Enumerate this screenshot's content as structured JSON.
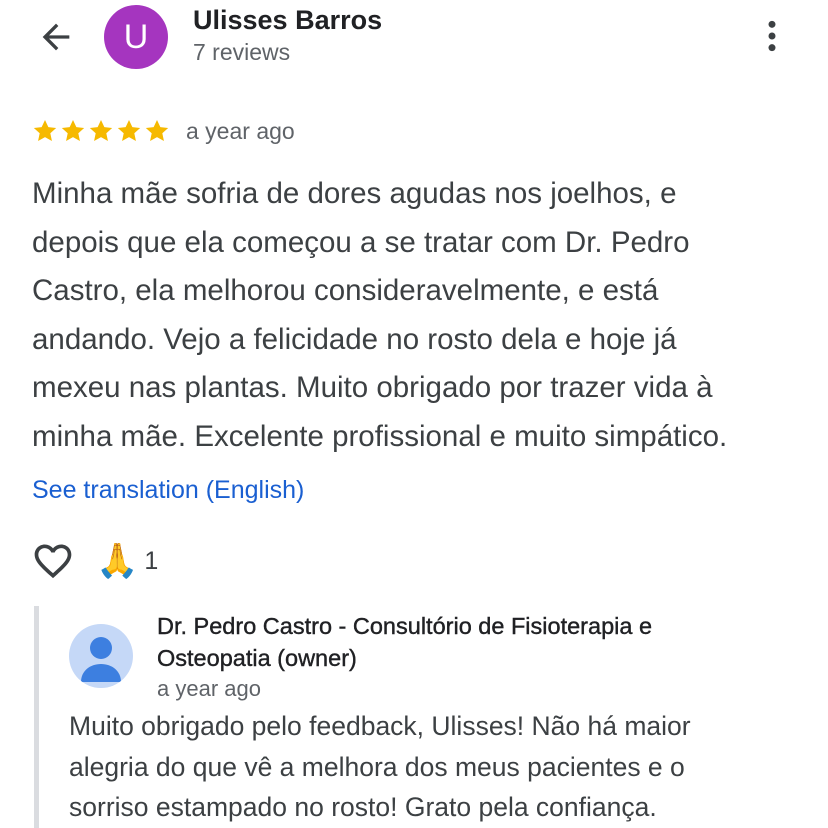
{
  "header": {
    "avatar_letter": "U",
    "avatar_color": "#a535bf",
    "reviewer_name": "Ulisses Barros",
    "reviewer_meta": "7 reviews",
    "back_icon": "arrow-left-icon",
    "more_icon": "more-vertical-icon"
  },
  "review": {
    "rating": 5,
    "rating_max": 5,
    "star_color": "#f6b900",
    "time": "a year ago",
    "text_lines": [
      "Minha mãe sofria de dores agudas nos joelhos, e",
      "depois que ela começou a se tratar com Dr. Pedro",
      "Castro, ela melhorou consideravelmente, e está",
      "andando. Vejo a felicidade no rosto dela e hoje já",
      "mexeu nas plantas. Muito obrigado por trazer vida à",
      "minha mãe. Excelente profissional e muito simpático."
    ],
    "translate_label": "See translation (English)",
    "link_color": "#1a5fd1"
  },
  "reactions": {
    "heart_icon": "heart-outline-icon",
    "emoji": "🙏",
    "count": "1"
  },
  "reply": {
    "owner_avatar_icon": "person-icon",
    "owner_name_lines": [
      "Dr. Pedro Castro - Consultório de Fisioterapia e",
      "Osteopatia (owner)"
    ],
    "time": "a year ago",
    "text_lines": [
      "Muito obrigado pelo feedback, Ulisses! Não há maior",
      "alegria do que vê a melhora dos meus pacientes e o",
      "sorriso estampado no rosto! Grato pela confiança."
    ]
  }
}
